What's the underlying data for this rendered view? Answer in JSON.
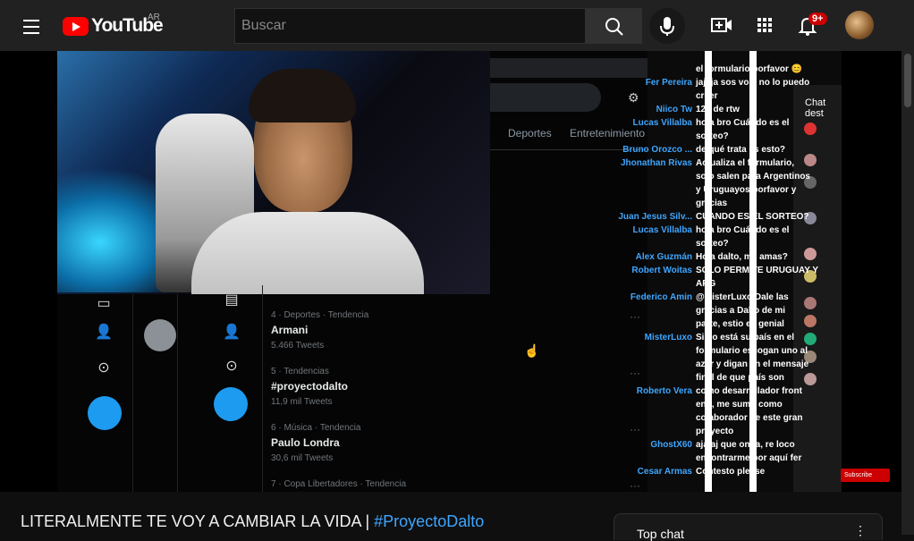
{
  "masthead": {
    "logo_text": "YouTube",
    "country_code": "AR",
    "search_placeholder": "Buscar",
    "notification_count": "9+",
    "icons": [
      "menu-icon",
      "search-icon",
      "microphone-icon",
      "create-video-icon",
      "apps-grid-icon",
      "bell-icon"
    ]
  },
  "player": {
    "browser": {
      "tabs": [
        "Deportes",
        "Entretenimiento"
      ]
    },
    "trends": [
      {
        "meta": "4 · Deportes · Tendencia",
        "name": "Armani",
        "count": "5.466 Tweets"
      },
      {
        "meta": "5 · Tendencias",
        "name": "#proyectodalto",
        "count": "11,9 mil Tweets"
      },
      {
        "meta": "6 · Música · Tendencia",
        "name": "Paulo Londra",
        "count": "30,6 mil Tweets"
      },
      {
        "meta": "7 · Copa Libertadores · Tendencia",
        "name": "",
        "count": ""
      }
    ],
    "chat": [
      {
        "author": "",
        "text": "el formulario porfavor 😊"
      },
      {
        "author": "Fer Pereira",
        "text": "jajaja sos vos, no lo puedo"
      },
      {
        "author": "",
        "text": "creer"
      },
      {
        "author": "Niico Tw",
        "text": "12k de rtw"
      },
      {
        "author": "Lucas Villalba",
        "text": "hola bro Cuándo es el"
      },
      {
        "author": "",
        "text": "sorteo?"
      },
      {
        "author": "Bruno Orozco ...",
        "text": "de qué trata es esto?"
      },
      {
        "author": "Jhonathan Rivas",
        "text": "Actualiza el formulario,"
      },
      {
        "author": "",
        "text": "solo salen para Argentinos"
      },
      {
        "author": "",
        "text": "y Uruguayos porfavor y"
      },
      {
        "author": "",
        "text": "gracias"
      },
      {
        "author": "Juan Jesus Silv...",
        "text": "CUANDO ES EL SORTEO?"
      },
      {
        "author": "Lucas Villalba",
        "text": "hola bro Cuándo es el"
      },
      {
        "author": "",
        "text": "sorteo?"
      },
      {
        "author": "Alex Guzmán",
        "text": "Hola dalto, me amas?"
      },
      {
        "author": "Robert Woitas",
        "text": "SOLO PERMITE URUGUAY Y"
      },
      {
        "author": "",
        "text": "ARG"
      },
      {
        "author": "Federico Amin",
        "text": "@MisterLuxo Dale las"
      },
      {
        "author": "",
        "text": "gracias a Dalto de mi"
      },
      {
        "author": "",
        "text": "parte, estio es genial"
      },
      {
        "author": "MisterLuxo",
        "text": "Si no está su país en el"
      },
      {
        "author": "",
        "text": "formulario escogan uno al"
      },
      {
        "author": "",
        "text": "azar y digan en el mensaje"
      },
      {
        "author": "",
        "text": "final de que país son"
      },
      {
        "author": "Roberto Vera",
        "text": "como desarrollador front"
      },
      {
        "author": "",
        "text": "end, me sumo como"
      },
      {
        "author": "",
        "text": "colaborador de este gran"
      },
      {
        "author": "",
        "text": "proyecto"
      },
      {
        "author": "GhostX60",
        "text": "ajajaj que onda, re loco"
      },
      {
        "author": "",
        "text": "encontrarme por aquí fer"
      },
      {
        "author": "Cesar Armas",
        "text": "Contesto please"
      }
    ],
    "side_chat_header": "Chat dest",
    "subscribe_label": "Subscribe"
  },
  "video": {
    "title_plain": "LITERALMENTE TE VOY A CAMBIAR LA VIDA | ",
    "title_hashtag": "#ProyectoDalto"
  },
  "live_chat": {
    "label": "Top chat"
  }
}
